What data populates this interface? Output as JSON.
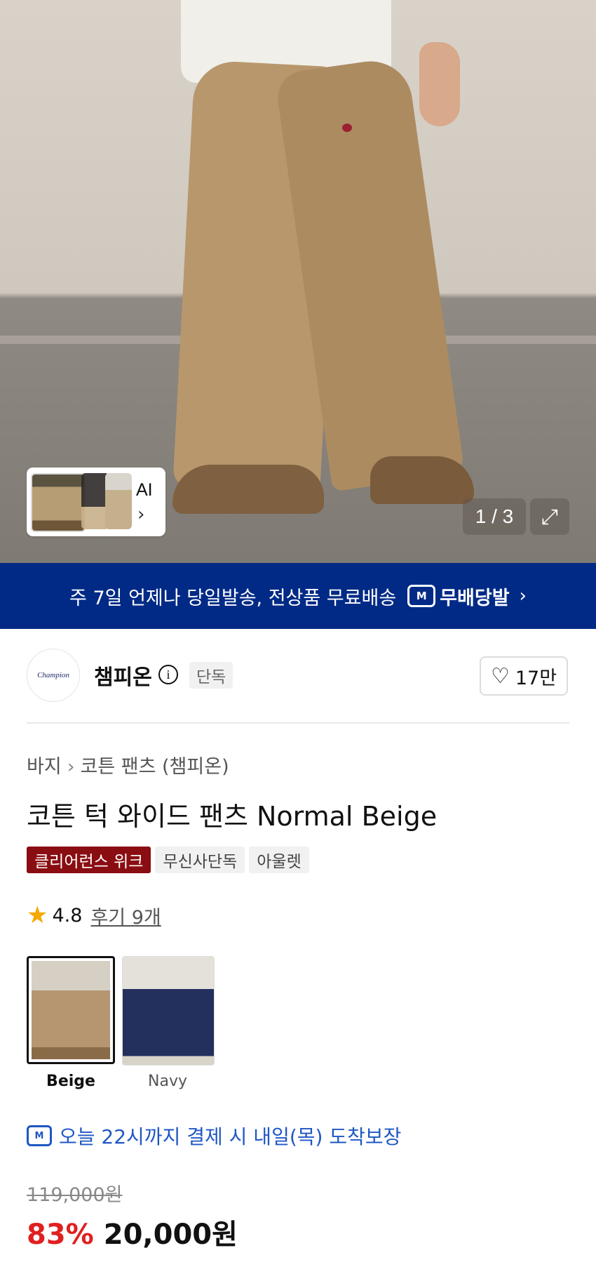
{
  "gallery": {
    "ai_label": "AI",
    "counter": "1 / 3"
  },
  "banner": {
    "text": "주 7일 언제나 당일발송, 전상품 무료배송",
    "badge_icon": "M",
    "brand": "무배당발",
    "arrow": "›"
  },
  "brand": {
    "logo_text": "Champion",
    "name": "챔피온",
    "badge": "단독",
    "likes": "17만"
  },
  "breadcrumb": {
    "category": "바지",
    "subcategory": "코튼 팬츠 (챔피온)"
  },
  "product": {
    "title": "코튼 턱 와이드 팬츠 Normal Beige",
    "tags": [
      "클리어런스 위크",
      "무신사단독",
      "아울렛"
    ],
    "rating": "4.8",
    "reviews": "후기 9개"
  },
  "options": [
    {
      "label": "Beige",
      "selected": true
    },
    {
      "label": "Navy",
      "selected": false
    }
  ],
  "delivery": {
    "text": "오늘 22시까지 결제 시 내일(목) 도착보장"
  },
  "price": {
    "original": "119,000원",
    "discount": "83%",
    "final": "20,000원"
  },
  "colors": {
    "banner_bg": "#002a86",
    "sale_red": "#e02020",
    "tag_red": "#8a0d12",
    "delivery_blue": "#1f57c3"
  }
}
